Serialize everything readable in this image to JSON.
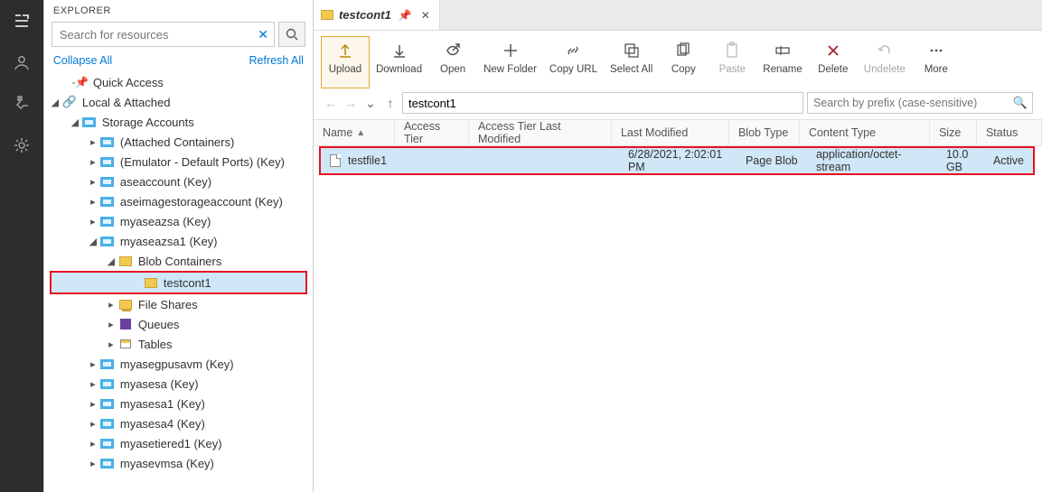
{
  "explorer": {
    "title": "EXPLORER",
    "search_placeholder": "Search for resources",
    "collapse": "Collapse All",
    "refresh": "Refresh All",
    "quick_access": "Quick Access",
    "local_attached": "Local & Attached",
    "storage_accounts": "Storage Accounts",
    "attached_containers": "(Attached Containers)",
    "emulator": "(Emulator - Default Ports) (Key)",
    "accounts": [
      "aseaccount (Key)",
      "aseimagestorageaccount (Key)",
      "myaseazsa (Key)"
    ],
    "expanded_account": "myaseazsa1 (Key)",
    "blob_containers": "Blob Containers",
    "selected_container": "testcont1",
    "subitems": [
      "File Shares",
      "Queues",
      "Tables"
    ],
    "more_accounts": [
      "myasegpusavm (Key)",
      "myasesa (Key)",
      "myasesa1 (Key)",
      "myasesa4 (Key)",
      "myasetiered1 (Key)",
      "myasevmsa (Key)"
    ]
  },
  "tab": {
    "title": "testcont1"
  },
  "toolbar": {
    "upload": "Upload",
    "download": "Download",
    "open": "Open",
    "new_folder": "New Folder",
    "copy_url": "Copy URL",
    "select_all": "Select All",
    "copy": "Copy",
    "paste": "Paste",
    "rename": "Rename",
    "delete": "Delete",
    "undelete": "Undelete",
    "more": "More"
  },
  "nav": {
    "path": "testcont1",
    "prefix_placeholder": "Search by prefix (case-sensitive)"
  },
  "columns": {
    "name": "Name",
    "tier": "Access Tier",
    "tier_modified": "Access Tier Last Modified",
    "modified": "Last Modified",
    "blob_type": "Blob Type",
    "content_type": "Content Type",
    "size": "Size",
    "status": "Status"
  },
  "files": [
    {
      "name": "testfile1",
      "tier": "",
      "tier_modified": "",
      "modified": "6/28/2021, 2:02:01 PM",
      "blob_type": "Page Blob",
      "content_type": "application/octet-stream",
      "size": "10.0 GB",
      "status": "Active"
    }
  ]
}
